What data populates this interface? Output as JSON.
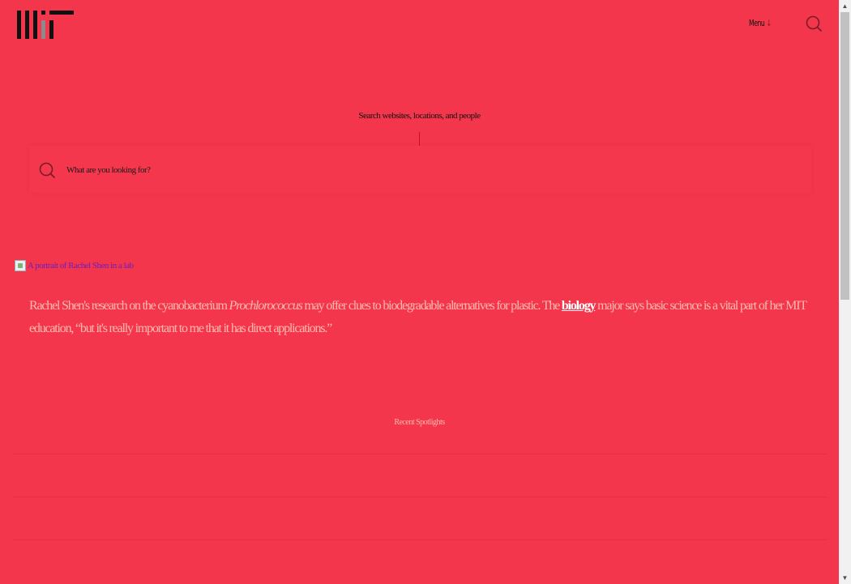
{
  "header": {
    "logo_name": "MIT",
    "menu_label": "Menu",
    "menu_arrow": "↓"
  },
  "search": {
    "heading": "Search websites, locations, and people",
    "placeholder": "What are you looking for?"
  },
  "spotlight": {
    "image_alt": "A portrait of Rachel Shen in a lab",
    "caption_part1": "Rachel Shen's research on the cyanobacterium ",
    "caption_italic": "Prochlorococcus",
    "caption_part2": " may offer clues to biodegradable alternatives for plastic. The ",
    "caption_link": "biology",
    "caption_part3": " major says basic science is a vital part of her MIT education, “but it's really important to me that it has direct applications.”"
  },
  "recent": {
    "label": "Recent Spotlights"
  },
  "colors": {
    "background": "#f4364c",
    "caption_text": "#ffb8ad",
    "link": "#ffffff"
  }
}
